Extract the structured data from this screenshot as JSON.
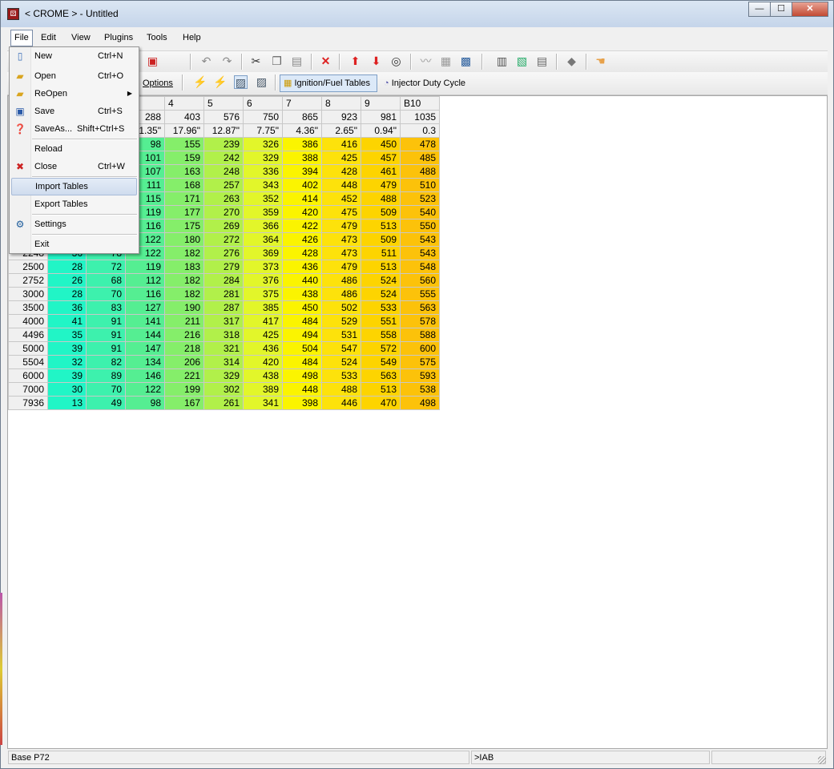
{
  "window": {
    "title": "< CROME > - Untitled",
    "min": "—",
    "max": "☐",
    "close": "✕"
  },
  "menubar": [
    "File",
    "Edit",
    "View",
    "Plugins",
    "Tools",
    "Help"
  ],
  "toolbar2": {
    "options_label": "Options",
    "ignition_label": "Ignition/Fuel Tables",
    "injector_label": "Injector Duty Cycle"
  },
  "file_menu": [
    {
      "label": "New",
      "shortcut": "Ctrl+N",
      "icon": "new-file-icon"
    },
    {
      "label": "Open",
      "shortcut": "Ctrl+O",
      "icon": "folder-open-icon"
    },
    {
      "label": "ReOpen",
      "shortcut": "",
      "icon": "folder-reopen-icon",
      "submenu": true
    },
    {
      "label": "Save",
      "shortcut": "Ctrl+S",
      "icon": "floppy-icon"
    },
    {
      "label": "SaveAs...",
      "shortcut": "Shift+Ctrl+S",
      "icon": "save-as-icon"
    },
    {
      "label": "Reload",
      "shortcut": "",
      "icon": ""
    },
    {
      "label": "Close",
      "shortcut": "Ctrl+W",
      "icon": "close-file-icon"
    },
    {
      "label": "Import Tables",
      "shortcut": "",
      "icon": "",
      "highlighted": true
    },
    {
      "label": "Export Tables",
      "shortcut": "",
      "icon": ""
    },
    {
      "label": "Settings",
      "shortcut": "",
      "icon": "settings-icon"
    },
    {
      "label": "Exit",
      "shortcut": "",
      "icon": ""
    }
  ],
  "table": {
    "col_headers": [
      "",
      "",
      "",
      "",
      "4",
      "5",
      "6",
      "7",
      "8",
      "9",
      "B10"
    ],
    "row1": [
      "",
      "",
      "",
      "288",
      "403",
      "576",
      "750",
      "865",
      "923",
      "981",
      "1035"
    ],
    "row2": [
      "",
      "",
      "",
      "1.35\"",
      "17.96\"",
      "12.87\"",
      "7.75\"",
      "4.36\"",
      "2.65\"",
      "0.94\"",
      "0.3"
    ],
    "rows": [
      {
        "rpm": "",
        "values": [
          "",
          "",
          "98",
          "155",
          "239",
          "326",
          "386",
          "416",
          "450",
          "478"
        ]
      },
      {
        "rpm": "",
        "values": [
          "",
          "",
          "101",
          "159",
          "242",
          "329",
          "388",
          "425",
          "457",
          "485"
        ]
      },
      {
        "rpm": "",
        "values": [
          "",
          "",
          "107",
          "163",
          "248",
          "336",
          "394",
          "428",
          "461",
          "488"
        ]
      },
      {
        "rpm": "",
        "values": [
          "",
          "",
          "111",
          "168",
          "257",
          "343",
          "402",
          "448",
          "479",
          "510"
        ]
      },
      {
        "rpm": "",
        "values": [
          "",
          "",
          "115",
          "171",
          "263",
          "352",
          "414",
          "452",
          "488",
          "523"
        ]
      },
      {
        "rpm": "",
        "values": [
          "",
          "",
          "119",
          "177",
          "270",
          "359",
          "420",
          "475",
          "509",
          "540"
        ]
      },
      {
        "rpm": "",
        "values": [
          "",
          "",
          "116",
          "175",
          "269",
          "366",
          "422",
          "479",
          "513",
          "550"
        ]
      },
      {
        "rpm": "",
        "values": [
          "",
          "",
          "122",
          "180",
          "272",
          "364",
          "426",
          "473",
          "509",
          "543"
        ]
      },
      {
        "rpm": "2248",
        "values": [
          "36",
          "78",
          "122",
          "182",
          "276",
          "369",
          "428",
          "473",
          "511",
          "543"
        ]
      },
      {
        "rpm": "2500",
        "values": [
          "28",
          "72",
          "119",
          "183",
          "279",
          "373",
          "436",
          "479",
          "513",
          "548"
        ]
      },
      {
        "rpm": "2752",
        "values": [
          "26",
          "68",
          "112",
          "182",
          "284",
          "376",
          "440",
          "486",
          "524",
          "560"
        ]
      },
      {
        "rpm": "3000",
        "values": [
          "28",
          "70",
          "116",
          "182",
          "281",
          "375",
          "438",
          "486",
          "524",
          "555"
        ]
      },
      {
        "rpm": "3500",
        "values": [
          "36",
          "83",
          "127",
          "190",
          "287",
          "385",
          "450",
          "502",
          "533",
          "563"
        ]
      },
      {
        "rpm": "4000",
        "values": [
          "41",
          "91",
          "141",
          "211",
          "317",
          "417",
          "484",
          "529",
          "551",
          "578"
        ]
      },
      {
        "rpm": "4496",
        "values": [
          "35",
          "91",
          "144",
          "216",
          "318",
          "425",
          "494",
          "531",
          "558",
          "588"
        ]
      },
      {
        "rpm": "5000",
        "values": [
          "39",
          "91",
          "147",
          "218",
          "321",
          "436",
          "504",
          "547",
          "572",
          "600"
        ]
      },
      {
        "rpm": "5504",
        "values": [
          "32",
          "82",
          "134",
          "206",
          "314",
          "420",
          "484",
          "524",
          "549",
          "575"
        ]
      },
      {
        "rpm": "6000",
        "values": [
          "39",
          "89",
          "146",
          "221",
          "329",
          "438",
          "498",
          "533",
          "563",
          "593"
        ]
      },
      {
        "rpm": "7000",
        "values": [
          "30",
          "70",
          "122",
          "199",
          "302",
          "389",
          "448",
          "488",
          "513",
          "538"
        ]
      },
      {
        "rpm": "7936",
        "values": [
          "13",
          "49",
          "98",
          "167",
          "261",
          "341",
          "398",
          "446",
          "470",
          "498"
        ]
      }
    ],
    "column_colors": [
      "#21f5c6",
      "#3df1ad",
      "#55ee92",
      "#85ee6a",
      "#b1f04a",
      "#e2f62a",
      "#fbf400",
      "#fde20b",
      "#fdd400",
      "#fcc20a"
    ]
  },
  "statusbar": {
    "left": "Base P72",
    "middle": ">IAB"
  }
}
